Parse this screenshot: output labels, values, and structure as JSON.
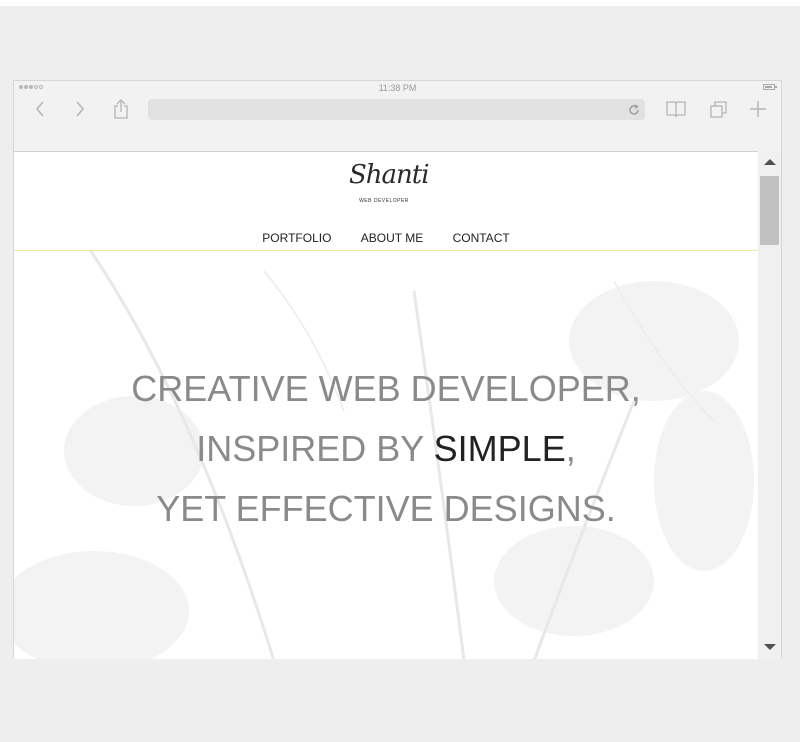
{
  "device": {
    "status_bar": {
      "time": "11:38 PM",
      "signal_icon": "signal-dots-icon",
      "battery_icon": "battery-icon"
    },
    "toolbar": {
      "icons": [
        "chevron-left-icon",
        "chevron-right-icon",
        "share-icon",
        "reload-icon",
        "book-icon",
        "tabs-icon",
        "plus-icon"
      ]
    }
  },
  "site": {
    "logo": {
      "script": "Shanti",
      "subtitle": "WEB DEVELOPER"
    },
    "nav": {
      "items": [
        "PORTFOLIO",
        "ABOUT ME",
        "CONTACT"
      ]
    },
    "hero": {
      "line1": "CREATIVE WEB DEVELOPER,",
      "line2_before": "INSPIRED BY ",
      "line2_highlight": "SIMPLE",
      "line2_after": ",",
      "line3": "YET EFFECTIVE DESIGNS."
    }
  },
  "colors": {
    "page_background": "#eeeeee",
    "hero_text": "#8a8a8a",
    "hero_highlight": "#222222",
    "header_border": "#f0e8a0"
  }
}
